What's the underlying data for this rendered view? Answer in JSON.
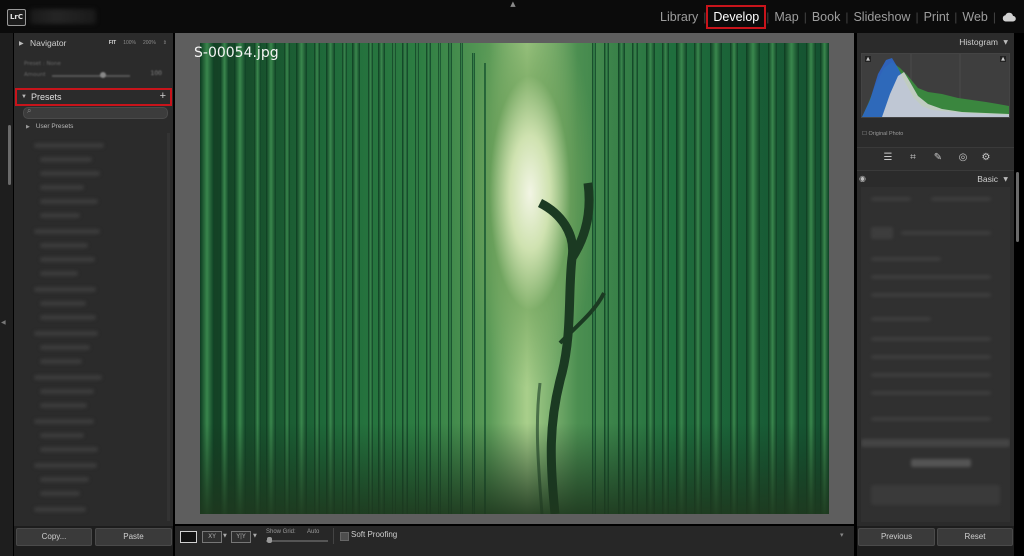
{
  "app": {
    "logo": "LrC"
  },
  "modules": [
    {
      "label": "Library",
      "active": false
    },
    {
      "label": "Develop",
      "active": true
    },
    {
      "label": "Map",
      "active": false
    },
    {
      "label": "Book",
      "active": false
    },
    {
      "label": "Slideshow",
      "active": false
    },
    {
      "label": "Print",
      "active": false
    },
    {
      "label": "Web",
      "active": false
    }
  ],
  "left_panel": {
    "navigator": {
      "title": "Navigator",
      "zoom_options": [
        "FIT",
        "100%",
        "200%"
      ]
    },
    "preset_amount": {
      "label": "Preset : None",
      "sub_label": "Amount",
      "value": "100",
      "amount_fraction": 1.0
    },
    "presets": {
      "title": "Presets",
      "add_symbol": "+",
      "user_presets_label": "User Presets"
    },
    "copy_label": "Copy...",
    "paste_label": "Paste"
  },
  "photo": {
    "filename": "S-00054.jpg"
  },
  "toolbar": {
    "show_grid_label": "Show Grid:",
    "grid_value": "Auto",
    "compare_label": "XY",
    "survey_label": "Y|Y",
    "soft_proofing_label": "Soft Proofing",
    "soft_proofing_checked": false
  },
  "right_panel": {
    "histogram_title": "Histogram",
    "original_photo_label": "Original Photo",
    "basic_title": "Basic",
    "previous_label": "Previous",
    "reset_label": "Reset"
  },
  "colors": {
    "accent_highlight": "#c8141b",
    "panel_bg": "#2b2b2b",
    "canvas_bg": "#5e5e5e"
  },
  "icons": [
    "lock-icon",
    "cloud-icon",
    "add-icon",
    "search-icon",
    "eye-icon",
    "edit-sliders-icon",
    "crop-icon",
    "heal-icon",
    "redeye-icon",
    "masking-icon"
  ]
}
